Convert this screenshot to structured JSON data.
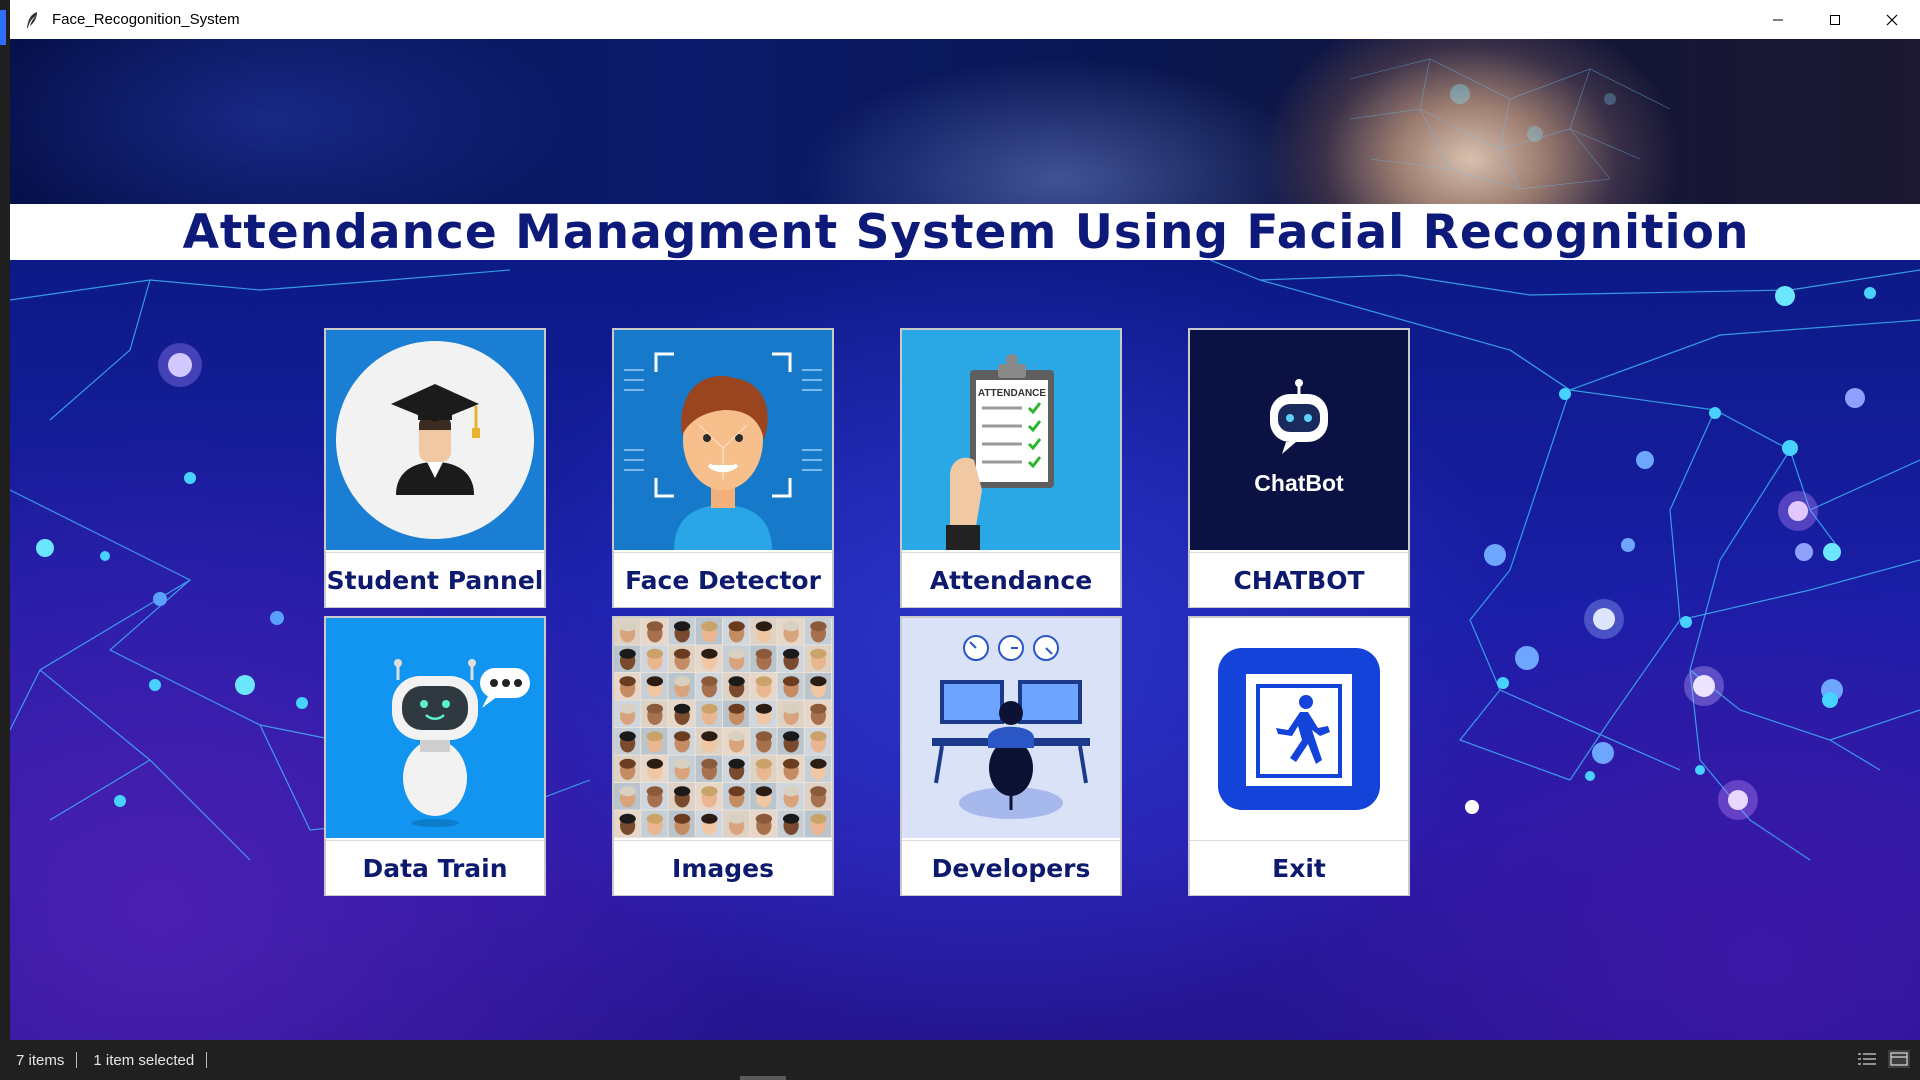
{
  "window": {
    "title": "Face_Recogonition_System",
    "controls": [
      "minimize",
      "maximize",
      "close"
    ]
  },
  "header": {
    "title": "Attendance Managment System Using Facial Recognition"
  },
  "tiles": [
    {
      "label": "Student Pannel",
      "icon": "student-graduate-icon"
    },
    {
      "label": "Face Detector",
      "icon": "face-scan-icon"
    },
    {
      "label": "Attendance",
      "icon": "attendance-clipboard-icon"
    },
    {
      "label": "CHATBOT",
      "icon": "chatbot-icon",
      "image_text": "ChatBot"
    },
    {
      "label": "Data Train",
      "icon": "robot-chat-icon"
    },
    {
      "label": "Images",
      "icon": "face-grid-icon"
    },
    {
      "label": "Developers",
      "icon": "developer-desk-icon"
    },
    {
      "label": "Exit",
      "icon": "exit-door-icon"
    }
  ],
  "statusbar": {
    "items_count": "7 items",
    "selected": "1 item selected"
  },
  "colors": {
    "heading": "#0d1a7a",
    "tile_label": "#0d1a6e",
    "background": "#1a1ea8"
  }
}
